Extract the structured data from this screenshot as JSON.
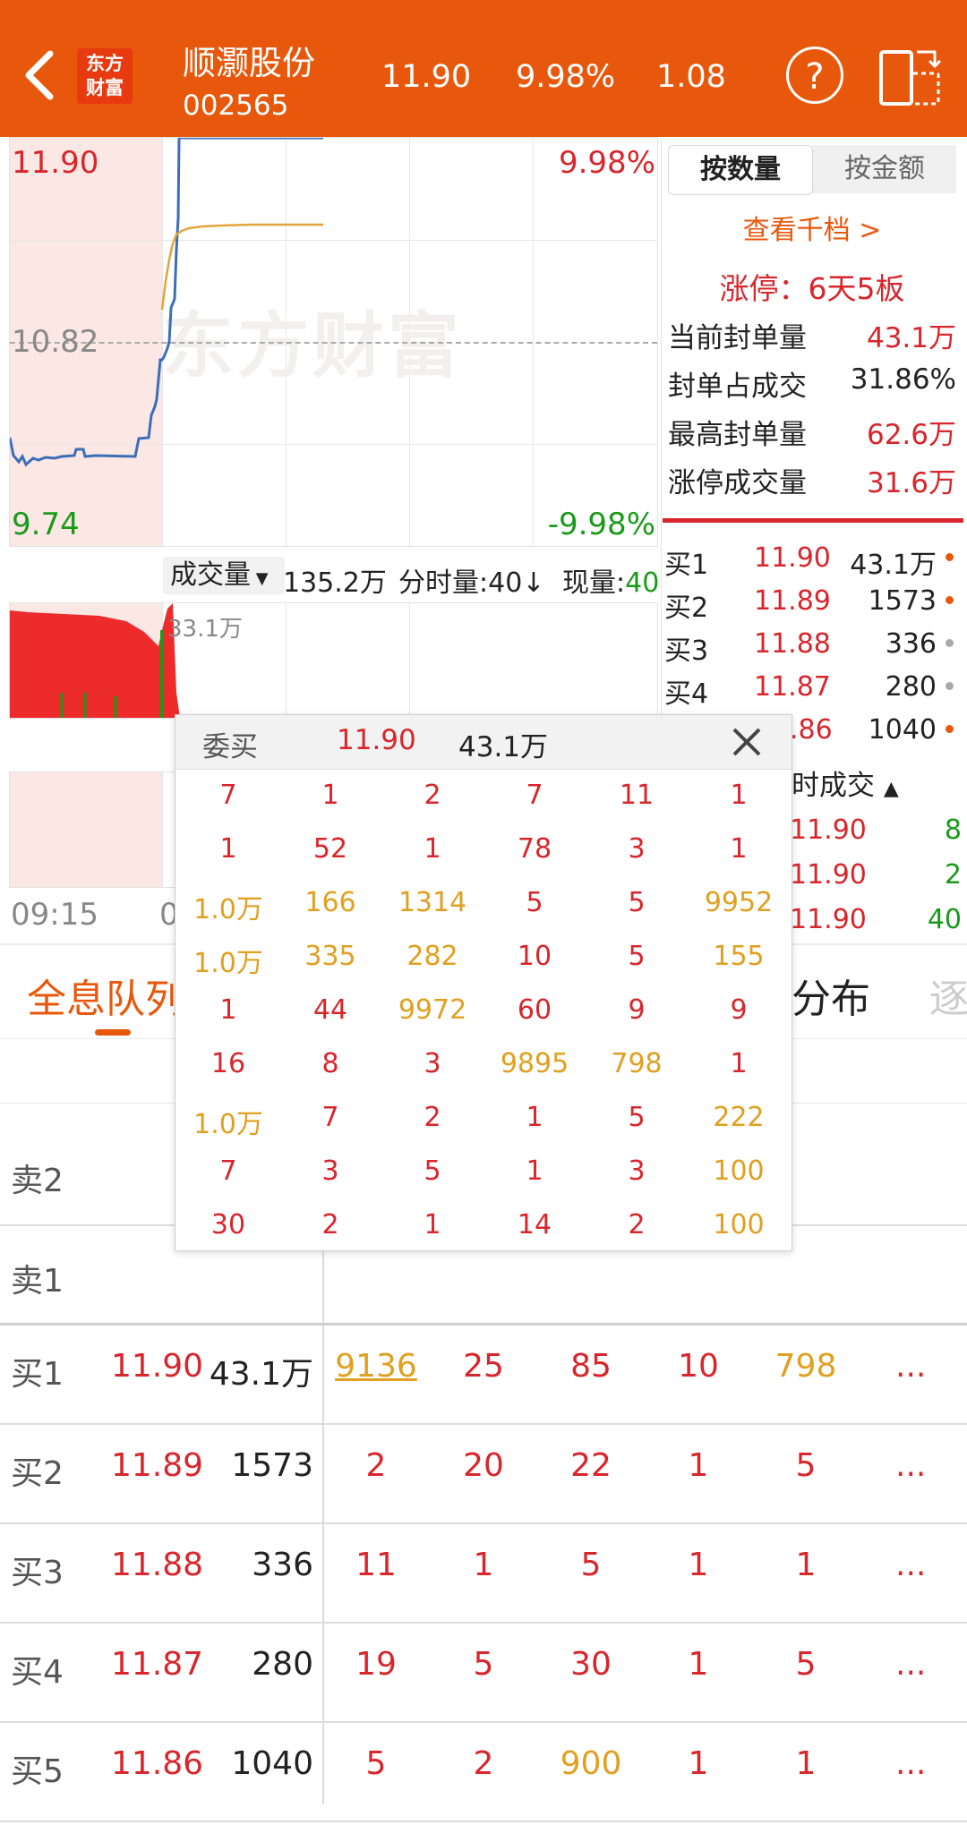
{
  "header": {
    "logo": [
      "东方",
      "财富"
    ],
    "stock_name": "顺灏股份",
    "stock_code": "002565",
    "price": "11.90",
    "change_pct": "9.98%",
    "change_amt": "1.08",
    "help_icon": "question-circle-icon",
    "switch_icon": "rotate-screen-icon"
  },
  "chart": {
    "price_high": "11.90",
    "pct_high": "9.98%",
    "price_mid": "10.82",
    "price_low": "9.74",
    "pct_low": "-9.98%",
    "watermark": "东方财富",
    "volume_label": "成交量",
    "volume_total": "135.2万",
    "min_vol_label": "分时量:40",
    "min_vol_arrow": "↓",
    "now_vol_label": "现量:",
    "now_vol_value": "40",
    "vol_peak": "33.1万",
    "time_start": "09:15",
    "time_partial": "0"
  },
  "right_panel": {
    "tab_qty": "按数量",
    "tab_amt": "按金额",
    "view_levels": "查看千档 >",
    "limit_up": "涨停：6天5板",
    "stats": [
      {
        "label": "当前封单量",
        "value": "43.1万"
      },
      {
        "label": "封单占成交",
        "value": "31.86%"
      },
      {
        "label": "最高封单量",
        "value": "62.6万"
      },
      {
        "label": "涨停成交量",
        "value": "31.6万"
      }
    ],
    "bids": [
      {
        "label": "买1",
        "price": "11.90",
        "qty": "43.1万"
      },
      {
        "label": "买2",
        "price": "11.89",
        "qty": "1573"
      },
      {
        "label": "买3",
        "price": "11.88",
        "qty": "336"
      },
      {
        "label": "买4",
        "price": "11.87",
        "qty": "280"
      },
      {
        "label": "",
        "price": ".86",
        "qty": "1040"
      }
    ],
    "trades_title": "时成交",
    "trades": [
      {
        "price": "11.90",
        "vol": "8"
      },
      {
        "price": "11.90",
        "vol": "2"
      },
      {
        "price": "11.90",
        "vol": "40"
      }
    ]
  },
  "tabs": {
    "full_queue": "全息队列",
    "distribution": "分布",
    "next_partial": "逐"
  },
  "popup": {
    "title": "委买",
    "price": "11.90",
    "qty": "43.1万",
    "close_icon": "close-icon",
    "rows": [
      [
        "7",
        "1",
        "2",
        "7",
        "11",
        "1"
      ],
      [
        "1",
        "52",
        "1",
        "78",
        "3",
        "1"
      ],
      [
        "1.0万",
        "166",
        "1314",
        "5",
        "5",
        "9952"
      ],
      [
        "1.0万",
        "335",
        "282",
        "10",
        "5",
        "155"
      ],
      [
        "1",
        "44",
        "9972",
        "60",
        "9",
        "9"
      ],
      [
        "16",
        "8",
        "3",
        "9895",
        "798",
        "1"
      ],
      [
        "1.0万",
        "7",
        "2",
        "1",
        "5",
        "222"
      ],
      [
        "7",
        "3",
        "5",
        "1",
        "3",
        "100"
      ],
      [
        "30",
        "2",
        "1",
        "14",
        "2",
        "100"
      ]
    ]
  },
  "table": {
    "sell_rows": [
      "卖2",
      "卖1"
    ],
    "buy_rows": [
      {
        "label": "买1",
        "price": "11.90",
        "qty": "43.1万",
        "orders": [
          "9136",
          "25",
          "85",
          "10",
          "798"
        ],
        "more": "..."
      },
      {
        "label": "买2",
        "price": "11.89",
        "qty": "1573",
        "orders": [
          "2",
          "20",
          "22",
          "1",
          "5"
        ],
        "more": "..."
      },
      {
        "label": "买3",
        "price": "11.88",
        "qty": "336",
        "orders": [
          "11",
          "1",
          "5",
          "1",
          "1"
        ],
        "more": "..."
      },
      {
        "label": "买4",
        "price": "11.87",
        "qty": "280",
        "orders": [
          "19",
          "5",
          "30",
          "1",
          "5"
        ],
        "more": "..."
      },
      {
        "label": "买5",
        "price": "11.86",
        "qty": "1040",
        "orders": [
          "5",
          "2",
          "900",
          "1",
          "1"
        ],
        "more": "..."
      }
    ]
  },
  "colors": {
    "brand": "#e8580c",
    "up": "#d8262c",
    "down": "#1a9a1a",
    "big": "#e0a020"
  }
}
